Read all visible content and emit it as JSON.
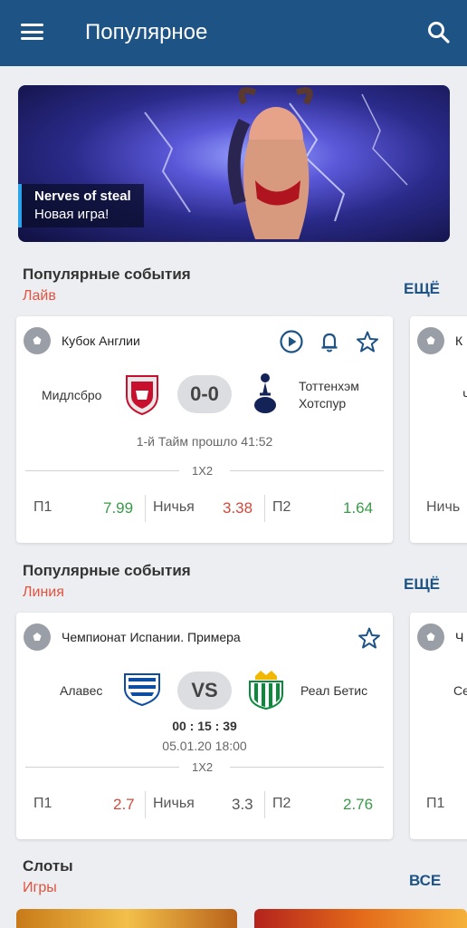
{
  "header": {
    "title": "Популярное",
    "menu_icon": "menu-icon",
    "search_icon": "search-icon",
    "bg": "#1e5386"
  },
  "banner": {
    "title": "Nerves of steal",
    "subtitle": "Новая игра!"
  },
  "live": {
    "title": "Популярные события",
    "subtitle": "Лайв",
    "more": "ЕЩЁ",
    "card": {
      "league": "Кубок Англии",
      "home": "Мидлсбро",
      "away_line1": "Тоттенхэм",
      "away_line2": "Хотспур",
      "score": "0-0",
      "status": "1-й Тайм прошло 41:52",
      "market": "1X2",
      "p1_label": "П1",
      "p1": "7.99",
      "draw_label": "Ничья",
      "draw": "3.38",
      "p2_label": "П2",
      "p2": "1.64"
    },
    "peek": {
      "label": "К",
      "draw_label": "Ничь",
      "line": "Ч"
    }
  },
  "line": {
    "title": "Популярные события",
    "subtitle": "Линия",
    "more": "ЕЩЁ",
    "card": {
      "league": "Чемпионат Испании. Примера",
      "home": "Алавес",
      "away": "Реал Бетис",
      "vs": "VS",
      "countdown": "00 : 15 : 39",
      "datetime": "05.01.20 18:00",
      "market": "1X2",
      "p1_label": "П1",
      "p1": "2.7",
      "draw_label": "Ничья",
      "draw": "3.3",
      "p2_label": "П2",
      "p2": "2.76"
    },
    "peek": {
      "label": "Ч",
      "team": "Се",
      "p1_label": "П1"
    }
  },
  "slots": {
    "title": "Слоты",
    "subtitle": "Игры",
    "more": "ВСЕ"
  }
}
